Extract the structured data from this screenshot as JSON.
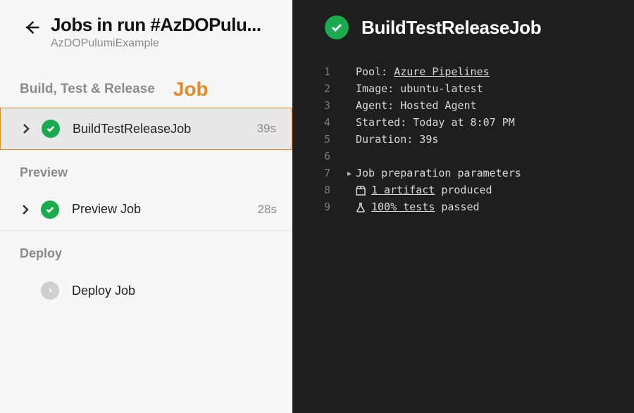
{
  "header": {
    "title": "Jobs in run #AzDOPulu...",
    "subtitle": "AzDOPulumiExample"
  },
  "annotation": "Job",
  "stages": [
    {
      "label": "Build, Test & Release",
      "jobs": [
        {
          "name": "BuildTestReleaseJob",
          "status": "success",
          "duration": "39s",
          "selected": true,
          "expandable": true
        }
      ]
    },
    {
      "label": "Preview",
      "jobs": [
        {
          "name": "Preview Job",
          "status": "success",
          "duration": "28s",
          "selected": false,
          "expandable": true
        }
      ]
    },
    {
      "label": "Deploy",
      "jobs": [
        {
          "name": "Deploy Job",
          "status": "pending",
          "duration": "",
          "selected": false,
          "expandable": false
        }
      ]
    }
  ],
  "detail": {
    "title": "BuildTestReleaseJob",
    "lines": {
      "1": {
        "label": "Pool: ",
        "link": "Azure Pipelines"
      },
      "2": {
        "text": "Image: ubuntu-latest"
      },
      "3": {
        "text": "Agent: Hosted Agent"
      },
      "4": {
        "text": "Started: Today at 8:07 PM"
      },
      "5": {
        "text": "Duration: 39s"
      },
      "7": {
        "text": "Job preparation parameters"
      },
      "8": {
        "link": "1 artifact",
        "suffix": " produced"
      },
      "9": {
        "link": "100% tests",
        "suffix": " passed"
      }
    }
  }
}
